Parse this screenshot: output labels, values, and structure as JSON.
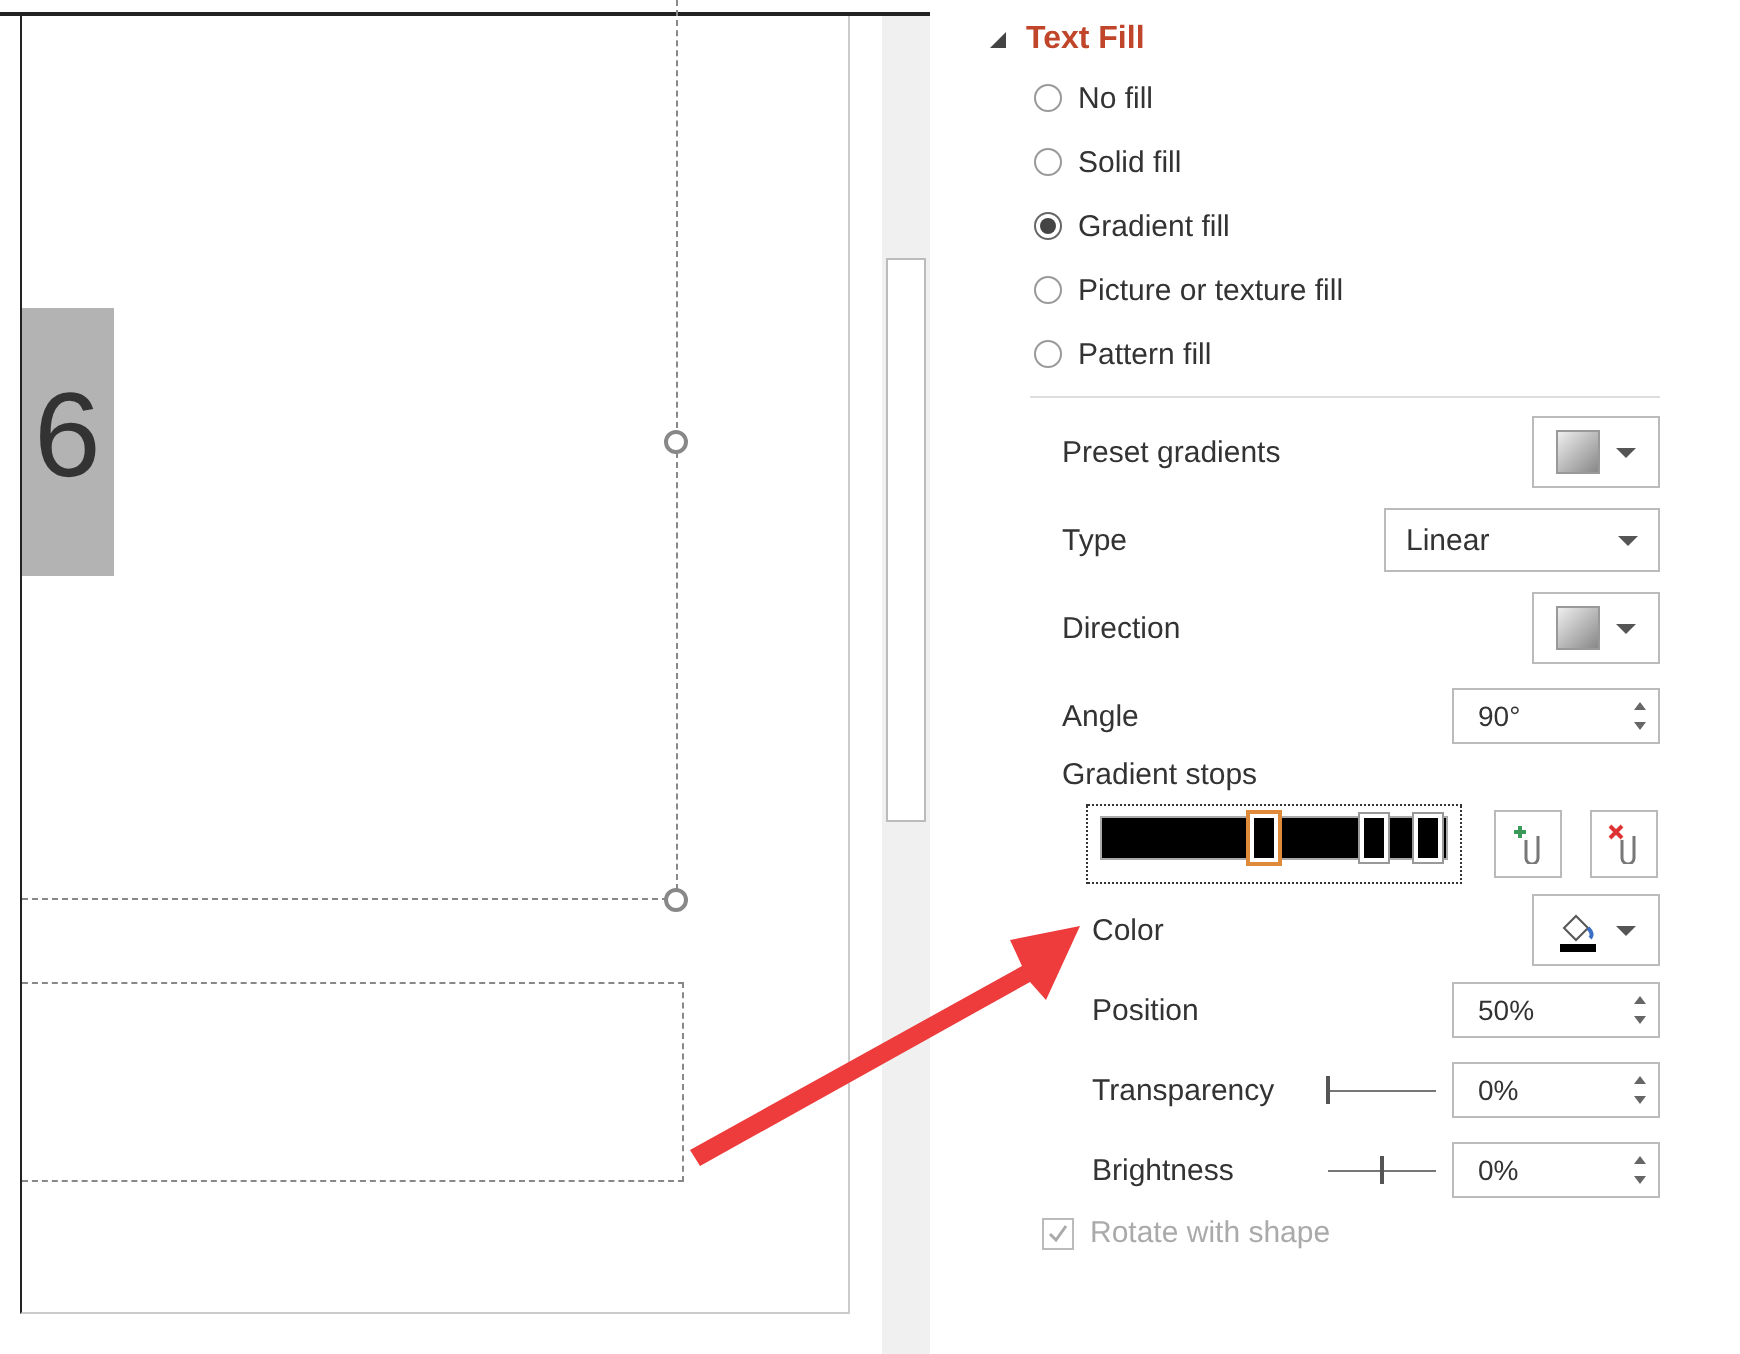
{
  "slide": {
    "digit": "6"
  },
  "panel": {
    "section": {
      "title": "Text Fill",
      "expanded": true
    },
    "fill_options": [
      {
        "label": "No fill",
        "selected": false
      },
      {
        "label": "Solid fill",
        "selected": false
      },
      {
        "label": "Gradient fill",
        "selected": true
      },
      {
        "label": "Picture or texture fill",
        "selected": false
      },
      {
        "label": "Pattern fill",
        "selected": false
      }
    ],
    "preset_gradients": {
      "label": "Preset gradients"
    },
    "type": {
      "label": "Type",
      "value": "Linear"
    },
    "direction": {
      "label": "Direction"
    },
    "angle": {
      "label": "Angle",
      "value": "90°"
    },
    "gradient_stops": {
      "label": "Gradient stops",
      "stops": [
        {
          "level": 0.47,
          "selected": true
        },
        {
          "level": 0.79,
          "selected": false
        },
        {
          "level": 0.95,
          "selected": false
        }
      ]
    },
    "color": {
      "label": "Color"
    },
    "position": {
      "label": "Position",
      "value": "50%"
    },
    "transparency": {
      "label": "Transparency",
      "value": "0%",
      "level": 0
    },
    "brightness": {
      "label": "Brightness",
      "value": "0%",
      "level": 0.5
    },
    "rotate_with_shape": {
      "label": "Rotate with shape",
      "checked": true,
      "disabled": true
    }
  }
}
